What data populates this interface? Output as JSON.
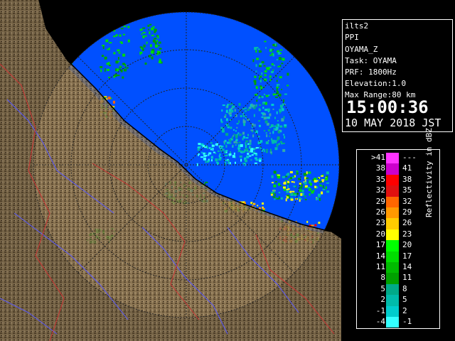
{
  "info": {
    "radar_id": "ilts2",
    "scan_type": "PPI",
    "product": "OYAMA_Z",
    "task": "Task: OYAMA",
    "prf": "PRF: 1800Hz",
    "elevation": "Elevation:1.0",
    "max_range": "Max Range:80 km",
    "time": "15:00:36",
    "date": "10 MAY 2018 JST"
  },
  "legend": {
    "unit_label": "Reflectivity in dBZ",
    "rows": [
      {
        "low": ">41",
        "high": "---",
        "color": "#ff33ff"
      },
      {
        "low": "38",
        "high": "41",
        "color": "#cc00cc"
      },
      {
        "low": "35",
        "high": "38",
        "color": "#ff0000"
      },
      {
        "low": "32",
        "high": "35",
        "color": "#e01010"
      },
      {
        "low": "29",
        "high": "32",
        "color": "#ff6600"
      },
      {
        "low": "26",
        "high": "29",
        "color": "#ff9900"
      },
      {
        "low": "23",
        "high": "26",
        "color": "#ffcc00"
      },
      {
        "low": "20",
        "high": "23",
        "color": "#ffff00"
      },
      {
        "low": "17",
        "high": "20",
        "color": "#00ff00"
      },
      {
        "low": "14",
        "high": "17",
        "color": "#00dd00"
      },
      {
        "low": "11",
        "high": "14",
        "color": "#00bb00"
      },
      {
        "low": "8",
        "high": "11",
        "color": "#00a000"
      },
      {
        "low": "5",
        "high": "8",
        "color": "#00aa88"
      },
      {
        "low": "2",
        "high": "5",
        "color": "#00bbaa"
      },
      {
        "low": "-1",
        "high": "2",
        "color": "#00cccc"
      },
      {
        "low": "-4",
        "high": "-1",
        "color": "#33ffff"
      }
    ]
  },
  "map": {
    "sea_color": "#0050ff",
    "land_color": "#7a6444",
    "outside_color": "#000000",
    "range_ring_color": "#222222",
    "river_color": "#5a5aff",
    "boundary_color": "#cc3333"
  }
}
